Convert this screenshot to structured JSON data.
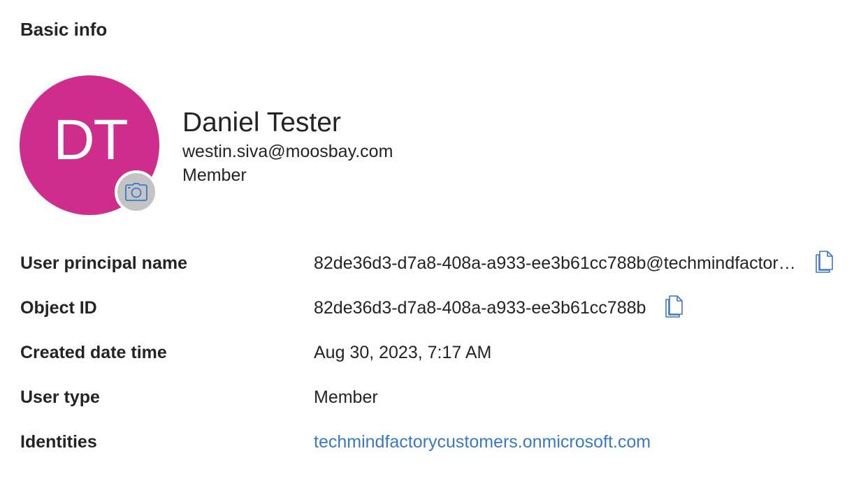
{
  "section": {
    "title": "Basic info"
  },
  "profile": {
    "initials": "DT",
    "display_name": "Daniel Tester",
    "email": "westin.siva@moosbay.com",
    "role": "Member",
    "avatar_color": "#cf2d8d",
    "camera_icon": "camera-icon"
  },
  "properties": [
    {
      "label": "User principal name",
      "value": "82de36d3-d7a8-408a-a933-ee3b61cc788b@techmindfactor…",
      "copy_icon": "copy-icon"
    },
    {
      "label": "Object ID",
      "value": "82de36d3-d7a8-408a-a933-ee3b61cc788b",
      "copy_icon": "copy-icon"
    },
    {
      "label": "Created date time",
      "value": "Aug 30, 2023, 7:17 AM"
    },
    {
      "label": "User type",
      "value": "Member"
    },
    {
      "label": "Identities",
      "value": "techmindfactorycustomers.onmicrosoft.com"
    }
  ],
  "colors": {
    "link": "#3a78c8",
    "text": "#242424",
    "camera_bg": "#c4c4c4"
  }
}
